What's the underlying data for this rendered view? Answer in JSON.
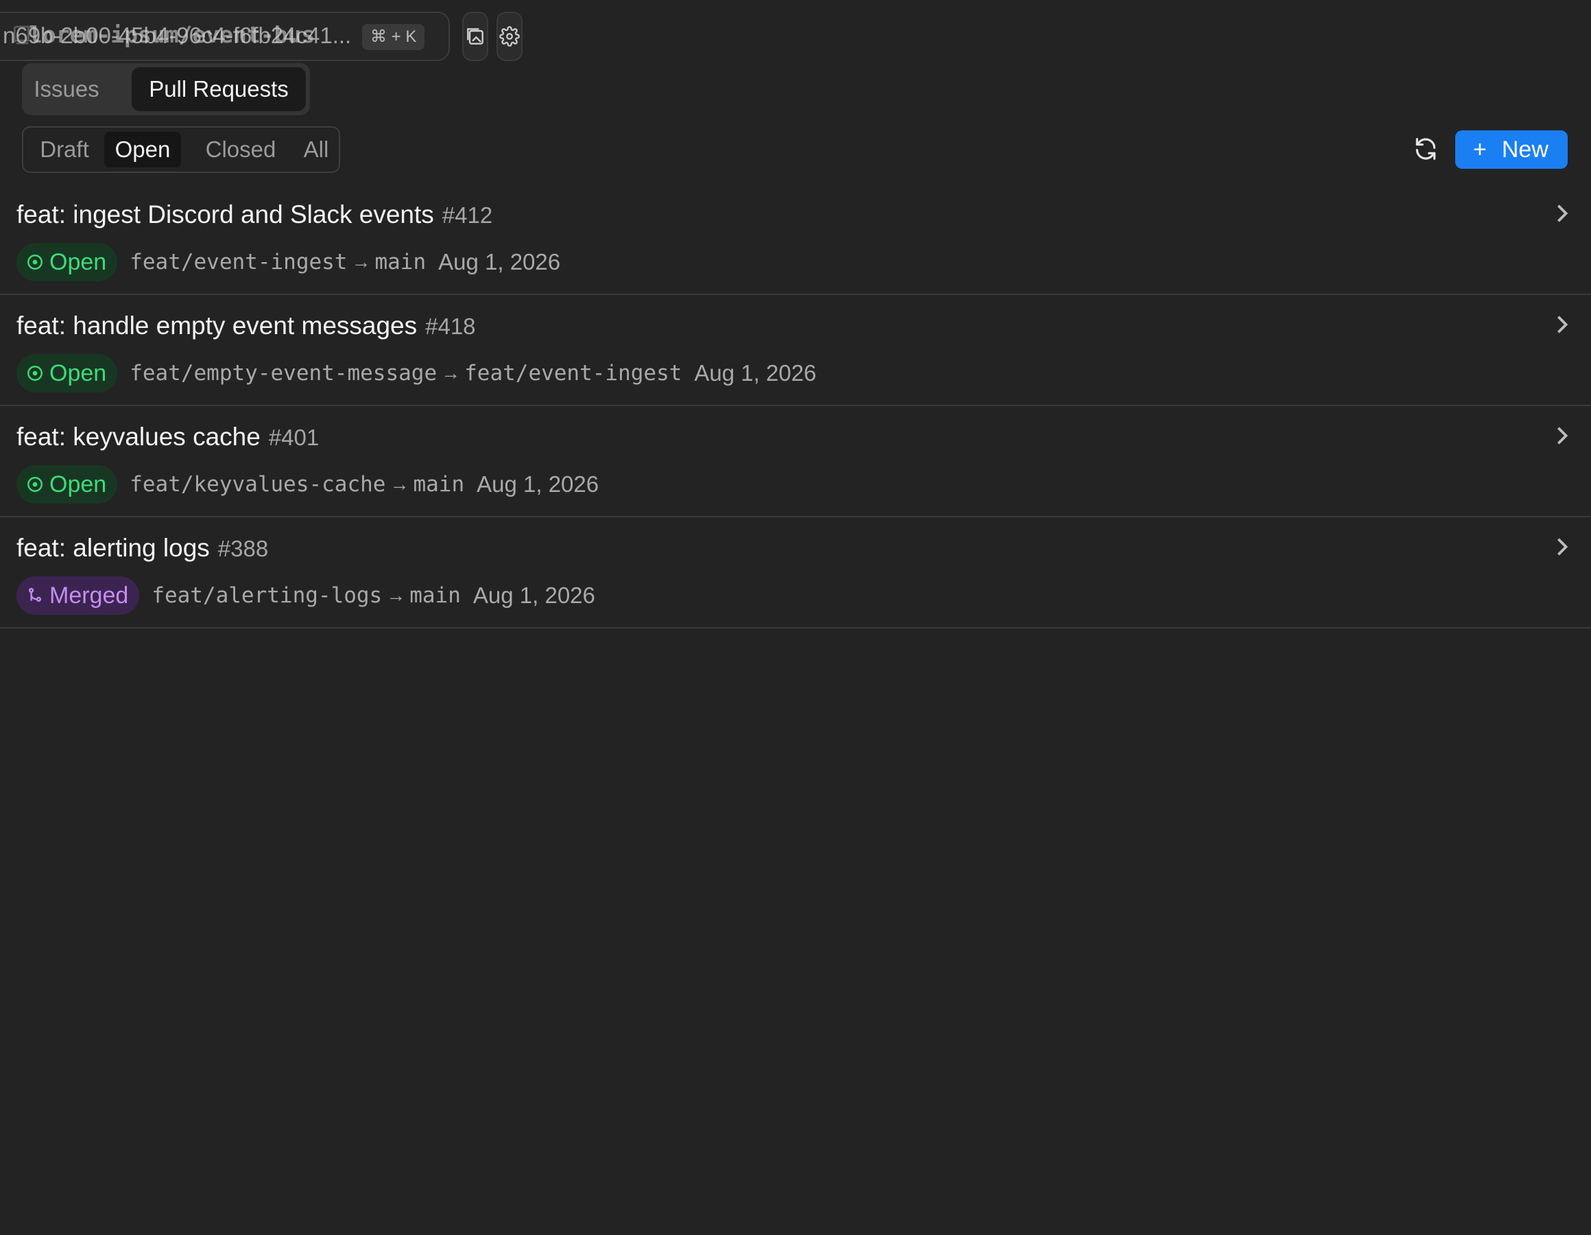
{
  "topbar": {
    "repo_back_text": "n69b-2b00-45b4-96c4-f6fb24c41...",
    "repo_front_text": "lorem-ipsum/event-bus",
    "shortcut": "⌘ + K",
    "icons": [
      "repo-icon",
      "screenshot-icon",
      "gear-icon"
    ]
  },
  "tabs": {
    "issues": "Issues",
    "pull_requests": "Pull Requests",
    "active": "Pull Requests"
  },
  "filters": {
    "draft": "Draft",
    "open": "Open",
    "closed": "Closed",
    "all": "All",
    "active": "Open"
  },
  "actions": {
    "new_label": "New",
    "plus": "+"
  },
  "colors": {
    "accent": "#1a7ff2",
    "open": "#3ddc78",
    "merged": "#c78bf2",
    "background": "#232323"
  },
  "pull_requests": [
    {
      "title": "feat: ingest Discord and Slack events",
      "number": "#412",
      "status": "Open",
      "source": "feat/event-ingest",
      "arrow": "→",
      "target": "main",
      "date": "Aug 1, 2026"
    },
    {
      "title": "feat: handle empty event messages",
      "number": "#418",
      "status": "Open",
      "source": "feat/empty-event-message",
      "arrow": "→",
      "target": "feat/event-ingest",
      "date": "Aug 1, 2026"
    },
    {
      "title": "feat: keyvalues cache",
      "number": "#401",
      "status": "Open",
      "source": "feat/keyvalues-cache",
      "arrow": "→",
      "target": "main",
      "date": "Aug 1, 2026"
    },
    {
      "title": "feat: alerting logs",
      "number": "#388",
      "status": "Merged",
      "source": "feat/alerting-logs",
      "arrow": "→",
      "target": "main",
      "date": "Aug 1, 2026"
    }
  ]
}
